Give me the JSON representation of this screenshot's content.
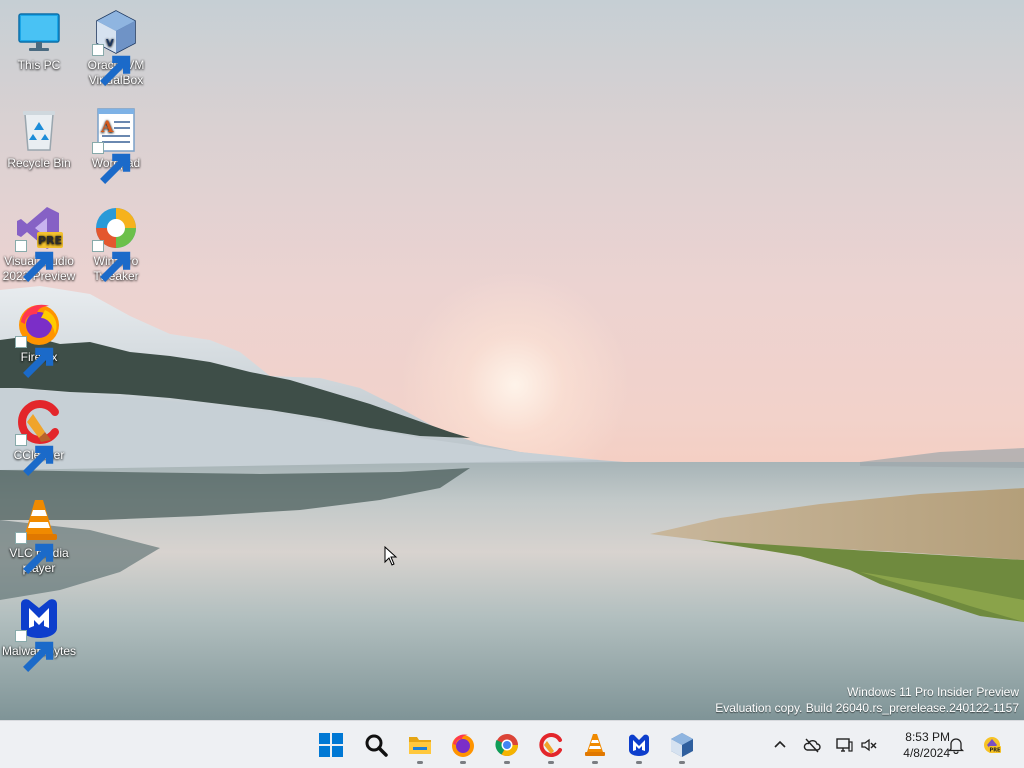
{
  "desktop_icons": [
    {
      "id": "this-pc",
      "label": "This PC",
      "shortcut": false,
      "icon": "monitor-icon"
    },
    {
      "id": "virtualbox",
      "label": "Oracle VM VirtualBox",
      "shortcut": true,
      "icon": "virtualbox-icon"
    },
    {
      "id": "recycle-bin",
      "label": "Recycle Bin",
      "shortcut": false,
      "icon": "recycle-bin-icon"
    },
    {
      "id": "wordpad",
      "label": "Wordpad",
      "shortcut": true,
      "icon": "wordpad-icon"
    },
    {
      "id": "visual-studio",
      "label": "Visual Studio 2022 Preview",
      "shortcut": true,
      "icon": "visual-studio-icon",
      "badge": "PRE"
    },
    {
      "id": "winaero",
      "label": "Winaero Tweaker",
      "shortcut": true,
      "icon": "winaero-icon"
    },
    {
      "id": "firefox",
      "label": "Firefox",
      "shortcut": true,
      "icon": "firefox-icon"
    },
    {
      "id": "ccleaner",
      "label": "CCleaner",
      "shortcut": true,
      "icon": "ccleaner-icon"
    },
    {
      "id": "vlc",
      "label": "VLC media player",
      "shortcut": true,
      "icon": "vlc-icon"
    },
    {
      "id": "malwarebytes",
      "label": "Malwarebytes",
      "shortcut": true,
      "icon": "malwarebytes-icon"
    }
  ],
  "watermark": {
    "line1": "Windows 11 Pro Insider Preview",
    "line2": "Evaluation copy. Build 26040.rs_prerelease.240122-1157"
  },
  "taskbar": {
    "apps": [
      {
        "id": "start",
        "icon": "windows-start-icon",
        "running": false
      },
      {
        "id": "search",
        "icon": "search-icon",
        "running": false
      },
      {
        "id": "file-explorer",
        "icon": "folder-icon",
        "running": true
      },
      {
        "id": "firefox",
        "icon": "firefox-icon",
        "running": true
      },
      {
        "id": "chrome",
        "icon": "chrome-icon",
        "running": true
      },
      {
        "id": "ccleaner",
        "icon": "ccleaner-icon",
        "running": true
      },
      {
        "id": "vlc",
        "icon": "vlc-icon",
        "running": true
      },
      {
        "id": "malwarebytes",
        "icon": "malwarebytes-icon",
        "running": true
      },
      {
        "id": "virtualbox",
        "icon": "virtualbox-icon",
        "running": true
      }
    ],
    "tray": {
      "icons": [
        "chevron-up-icon",
        "onedrive-offline-icon",
        "network-icon",
        "volume-muted-icon",
        "notification-bell-icon",
        "dev-pre-icon"
      ],
      "time": "8:53 PM",
      "date": "4/8/2024"
    }
  },
  "colors": {
    "taskbar_bg": "#eef0f3",
    "win_blue": "#0078d4",
    "vs_purple": "#8661c5",
    "malwarebytes_blue": "#0d3ecc",
    "vlc_orange": "#f08a00"
  }
}
